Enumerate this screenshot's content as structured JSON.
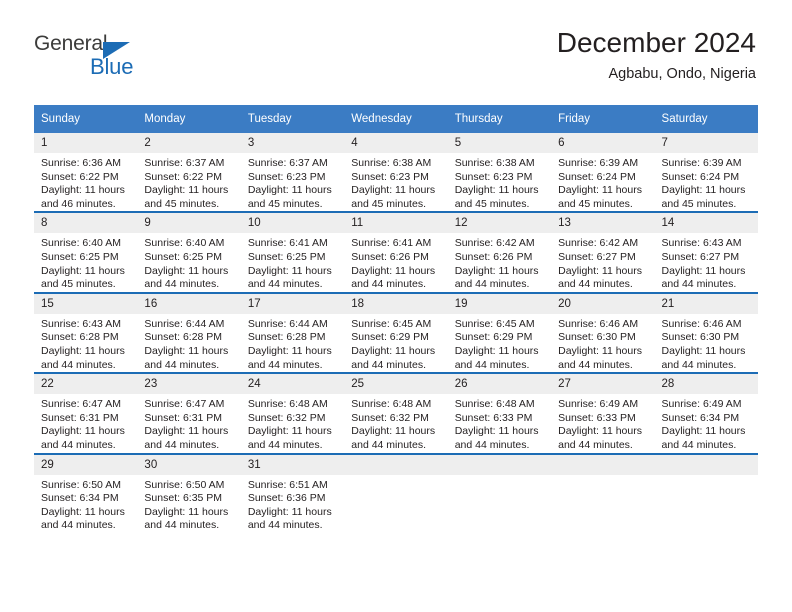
{
  "brand": {
    "name_part1": "General",
    "name_part2": "Blue",
    "accent_color": "#1c6cb5",
    "triangle_icon": "triangle-icon"
  },
  "header": {
    "title": "December 2024",
    "subtitle": "Agbabu, Ondo, Nigeria"
  },
  "calendar": {
    "header_bg": "#3b7cc4",
    "row_divider_color": "#1c6cb5",
    "daynum_bg": "#eeeeee",
    "weekdays": [
      "Sunday",
      "Monday",
      "Tuesday",
      "Wednesday",
      "Thursday",
      "Friday",
      "Saturday"
    ],
    "labels": {
      "sunrise": "Sunrise:",
      "sunset": "Sunset:",
      "daylight": "Daylight:"
    },
    "weeks": [
      [
        {
          "day": "1",
          "sunrise": "Sunrise: 6:36 AM",
          "sunset": "Sunset: 6:22 PM",
          "daylight_line1": "Daylight: 11 hours",
          "daylight_line2": "and 46 minutes."
        },
        {
          "day": "2",
          "sunrise": "Sunrise: 6:37 AM",
          "sunset": "Sunset: 6:22 PM",
          "daylight_line1": "Daylight: 11 hours",
          "daylight_line2": "and 45 minutes."
        },
        {
          "day": "3",
          "sunrise": "Sunrise: 6:37 AM",
          "sunset": "Sunset: 6:23 PM",
          "daylight_line1": "Daylight: 11 hours",
          "daylight_line2": "and 45 minutes."
        },
        {
          "day": "4",
          "sunrise": "Sunrise: 6:38 AM",
          "sunset": "Sunset: 6:23 PM",
          "daylight_line1": "Daylight: 11 hours",
          "daylight_line2": "and 45 minutes."
        },
        {
          "day": "5",
          "sunrise": "Sunrise: 6:38 AM",
          "sunset": "Sunset: 6:23 PM",
          "daylight_line1": "Daylight: 11 hours",
          "daylight_line2": "and 45 minutes."
        },
        {
          "day": "6",
          "sunrise": "Sunrise: 6:39 AM",
          "sunset": "Sunset: 6:24 PM",
          "daylight_line1": "Daylight: 11 hours",
          "daylight_line2": "and 45 minutes."
        },
        {
          "day": "7",
          "sunrise": "Sunrise: 6:39 AM",
          "sunset": "Sunset: 6:24 PM",
          "daylight_line1": "Daylight: 11 hours",
          "daylight_line2": "and 45 minutes."
        }
      ],
      [
        {
          "day": "8",
          "sunrise": "Sunrise: 6:40 AM",
          "sunset": "Sunset: 6:25 PM",
          "daylight_line1": "Daylight: 11 hours",
          "daylight_line2": "and 45 minutes."
        },
        {
          "day": "9",
          "sunrise": "Sunrise: 6:40 AM",
          "sunset": "Sunset: 6:25 PM",
          "daylight_line1": "Daylight: 11 hours",
          "daylight_line2": "and 44 minutes."
        },
        {
          "day": "10",
          "sunrise": "Sunrise: 6:41 AM",
          "sunset": "Sunset: 6:25 PM",
          "daylight_line1": "Daylight: 11 hours",
          "daylight_line2": "and 44 minutes."
        },
        {
          "day": "11",
          "sunrise": "Sunrise: 6:41 AM",
          "sunset": "Sunset: 6:26 PM",
          "daylight_line1": "Daylight: 11 hours",
          "daylight_line2": "and 44 minutes."
        },
        {
          "day": "12",
          "sunrise": "Sunrise: 6:42 AM",
          "sunset": "Sunset: 6:26 PM",
          "daylight_line1": "Daylight: 11 hours",
          "daylight_line2": "and 44 minutes."
        },
        {
          "day": "13",
          "sunrise": "Sunrise: 6:42 AM",
          "sunset": "Sunset: 6:27 PM",
          "daylight_line1": "Daylight: 11 hours",
          "daylight_line2": "and 44 minutes."
        },
        {
          "day": "14",
          "sunrise": "Sunrise: 6:43 AM",
          "sunset": "Sunset: 6:27 PM",
          "daylight_line1": "Daylight: 11 hours",
          "daylight_line2": "and 44 minutes."
        }
      ],
      [
        {
          "day": "15",
          "sunrise": "Sunrise: 6:43 AM",
          "sunset": "Sunset: 6:28 PM",
          "daylight_line1": "Daylight: 11 hours",
          "daylight_line2": "and 44 minutes."
        },
        {
          "day": "16",
          "sunrise": "Sunrise: 6:44 AM",
          "sunset": "Sunset: 6:28 PM",
          "daylight_line1": "Daylight: 11 hours",
          "daylight_line2": "and 44 minutes."
        },
        {
          "day": "17",
          "sunrise": "Sunrise: 6:44 AM",
          "sunset": "Sunset: 6:28 PM",
          "daylight_line1": "Daylight: 11 hours",
          "daylight_line2": "and 44 minutes."
        },
        {
          "day": "18",
          "sunrise": "Sunrise: 6:45 AM",
          "sunset": "Sunset: 6:29 PM",
          "daylight_line1": "Daylight: 11 hours",
          "daylight_line2": "and 44 minutes."
        },
        {
          "day": "19",
          "sunrise": "Sunrise: 6:45 AM",
          "sunset": "Sunset: 6:29 PM",
          "daylight_line1": "Daylight: 11 hours",
          "daylight_line2": "and 44 minutes."
        },
        {
          "day": "20",
          "sunrise": "Sunrise: 6:46 AM",
          "sunset": "Sunset: 6:30 PM",
          "daylight_line1": "Daylight: 11 hours",
          "daylight_line2": "and 44 minutes."
        },
        {
          "day": "21",
          "sunrise": "Sunrise: 6:46 AM",
          "sunset": "Sunset: 6:30 PM",
          "daylight_line1": "Daylight: 11 hours",
          "daylight_line2": "and 44 minutes."
        }
      ],
      [
        {
          "day": "22",
          "sunrise": "Sunrise: 6:47 AM",
          "sunset": "Sunset: 6:31 PM",
          "daylight_line1": "Daylight: 11 hours",
          "daylight_line2": "and 44 minutes."
        },
        {
          "day": "23",
          "sunrise": "Sunrise: 6:47 AM",
          "sunset": "Sunset: 6:31 PM",
          "daylight_line1": "Daylight: 11 hours",
          "daylight_line2": "and 44 minutes."
        },
        {
          "day": "24",
          "sunrise": "Sunrise: 6:48 AM",
          "sunset": "Sunset: 6:32 PM",
          "daylight_line1": "Daylight: 11 hours",
          "daylight_line2": "and 44 minutes."
        },
        {
          "day": "25",
          "sunrise": "Sunrise: 6:48 AM",
          "sunset": "Sunset: 6:32 PM",
          "daylight_line1": "Daylight: 11 hours",
          "daylight_line2": "and 44 minutes."
        },
        {
          "day": "26",
          "sunrise": "Sunrise: 6:48 AM",
          "sunset": "Sunset: 6:33 PM",
          "daylight_line1": "Daylight: 11 hours",
          "daylight_line2": "and 44 minutes."
        },
        {
          "day": "27",
          "sunrise": "Sunrise: 6:49 AM",
          "sunset": "Sunset: 6:33 PM",
          "daylight_line1": "Daylight: 11 hours",
          "daylight_line2": "and 44 minutes."
        },
        {
          "day": "28",
          "sunrise": "Sunrise: 6:49 AM",
          "sunset": "Sunset: 6:34 PM",
          "daylight_line1": "Daylight: 11 hours",
          "daylight_line2": "and 44 minutes."
        }
      ],
      [
        {
          "day": "29",
          "sunrise": "Sunrise: 6:50 AM",
          "sunset": "Sunset: 6:34 PM",
          "daylight_line1": "Daylight: 11 hours",
          "daylight_line2": "and 44 minutes."
        },
        {
          "day": "30",
          "sunrise": "Sunrise: 6:50 AM",
          "sunset": "Sunset: 6:35 PM",
          "daylight_line1": "Daylight: 11 hours",
          "daylight_line2": "and 44 minutes."
        },
        {
          "day": "31",
          "sunrise": "Sunrise: 6:51 AM",
          "sunset": "Sunset: 6:36 PM",
          "daylight_line1": "Daylight: 11 hours",
          "daylight_line2": "and 44 minutes."
        },
        {
          "day": "",
          "sunrise": "",
          "sunset": "",
          "daylight_line1": "",
          "daylight_line2": ""
        },
        {
          "day": "",
          "sunrise": "",
          "sunset": "",
          "daylight_line1": "",
          "daylight_line2": ""
        },
        {
          "day": "",
          "sunrise": "",
          "sunset": "",
          "daylight_line1": "",
          "daylight_line2": ""
        },
        {
          "day": "",
          "sunrise": "",
          "sunset": "",
          "daylight_line1": "",
          "daylight_line2": ""
        }
      ]
    ]
  }
}
